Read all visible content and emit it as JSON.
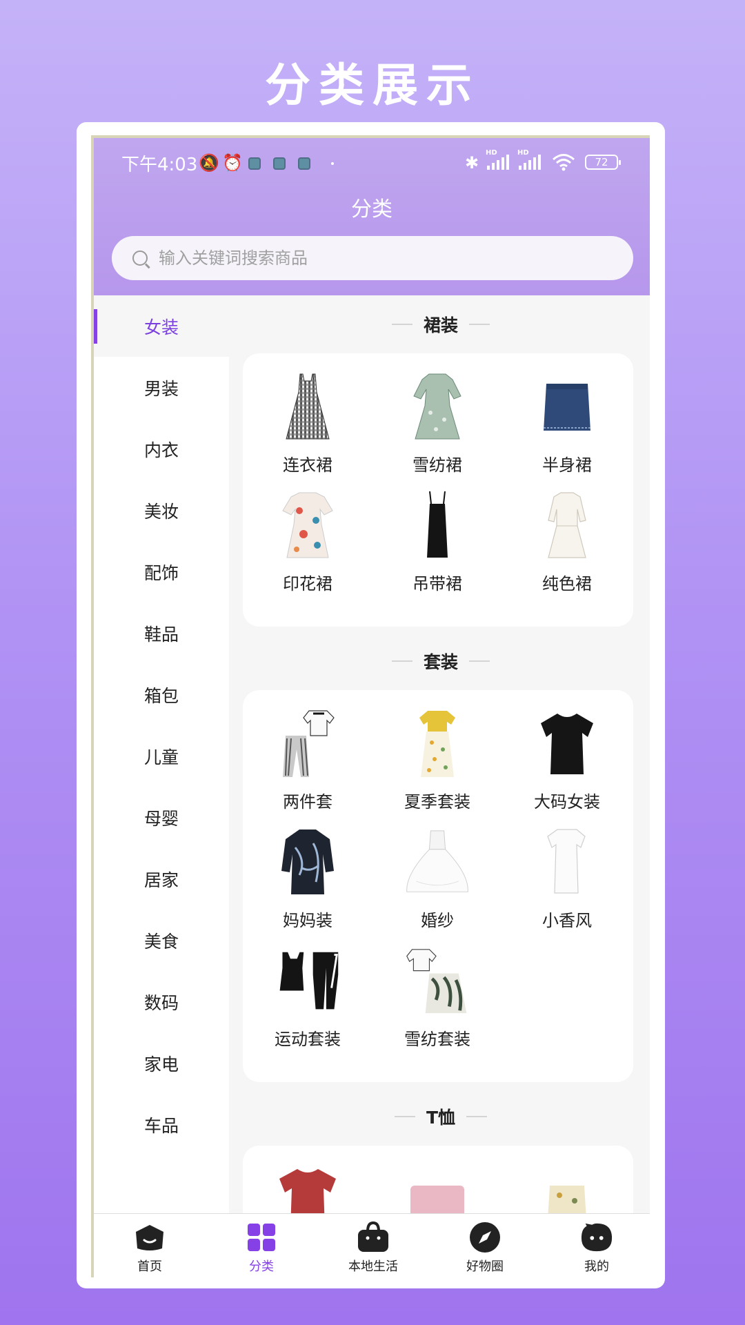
{
  "banner": {
    "title": "分类展示"
  },
  "status_bar": {
    "time": "下午4:03",
    "battery": "72",
    "hd1": "HD",
    "hd2": "HD"
  },
  "header": {
    "title": "分类"
  },
  "search": {
    "placeholder": "输入关键词搜索商品"
  },
  "sidebar": {
    "items": [
      {
        "label": "女装",
        "active": true
      },
      {
        "label": "男装"
      },
      {
        "label": "内衣"
      },
      {
        "label": "美妆"
      },
      {
        "label": "配饰"
      },
      {
        "label": "鞋品"
      },
      {
        "label": "箱包"
      },
      {
        "label": "儿童"
      },
      {
        "label": "母婴"
      },
      {
        "label": "居家"
      },
      {
        "label": "美食"
      },
      {
        "label": "数码"
      },
      {
        "label": "家电"
      },
      {
        "label": "车品"
      }
    ]
  },
  "sections": [
    {
      "title": "裙装",
      "items": [
        {
          "label": "连衣裙",
          "icon": "plaid-dress-icon"
        },
        {
          "label": "雪纺裙",
          "icon": "chiffon-dress-icon"
        },
        {
          "label": "半身裙",
          "icon": "denim-skirt-icon"
        },
        {
          "label": "印花裙",
          "icon": "print-dress-icon"
        },
        {
          "label": "吊带裙",
          "icon": "slip-dress-icon"
        },
        {
          "label": "纯色裙",
          "icon": "white-dress-icon"
        }
      ]
    },
    {
      "title": "套装",
      "items": [
        {
          "label": "两件套",
          "icon": "two-piece-set-icon"
        },
        {
          "label": "夏季套装",
          "icon": "summer-set-icon"
        },
        {
          "label": "大码女装",
          "icon": "black-tshirt-icon"
        },
        {
          "label": "妈妈装",
          "icon": "mom-blouse-icon"
        },
        {
          "label": "婚纱",
          "icon": "wedding-dress-icon"
        },
        {
          "label": "小香风",
          "icon": "chanel-style-dress-icon"
        },
        {
          "label": "运动套装",
          "icon": "sport-set-icon"
        },
        {
          "label": "雪纺套装",
          "icon": "chiffon-set-icon"
        }
      ]
    },
    {
      "title": "T恤",
      "items": []
    }
  ],
  "tabbar": {
    "items": [
      {
        "label": "首页",
        "icon": "home-icon"
      },
      {
        "label": "分类",
        "icon": "category-grid-icon",
        "active": true
      },
      {
        "label": "本地生活",
        "icon": "shopping-bag-icon"
      },
      {
        "label": "好物圈",
        "icon": "compass-icon"
      },
      {
        "label": "我的",
        "icon": "profile-face-icon"
      }
    ]
  },
  "colors": {
    "accent": "#8540e6",
    "header": "#b99bee"
  }
}
